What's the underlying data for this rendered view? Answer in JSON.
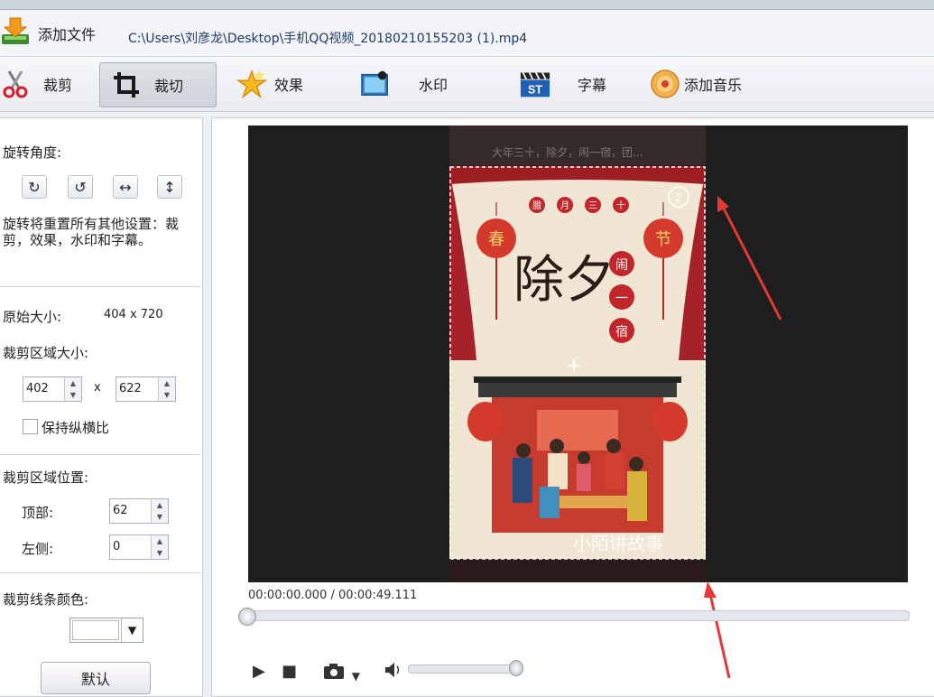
{
  "file_bar": {
    "add_file_label": "添加文件",
    "file_path": "C:\\Users\\刘彦龙\\Desktop\\手机QQ视频_20180210155203 (1).mp4"
  },
  "toolbar": {
    "items": [
      {
        "label": "裁剪",
        "icon": "scissors-icon"
      },
      {
        "label": "裁切",
        "icon": "crop-icon",
        "active": true
      },
      {
        "label": "效果",
        "icon": "star-effect-icon"
      },
      {
        "label": "水印",
        "icon": "watermark-icon"
      },
      {
        "label": "字幕",
        "icon": "subtitle-st-icon"
      },
      {
        "label": "添加音乐",
        "icon": "music-disc-icon"
      }
    ]
  },
  "left_panel": {
    "rotate_label": "旋转角度:",
    "rotate_buttons": [
      {
        "icon": "rotate-clockwise-icon",
        "glyph": "↻"
      },
      {
        "icon": "rotate-counterclockwise-icon",
        "glyph": "↺"
      },
      {
        "icon": "flip-horizontal-icon",
        "glyph": "↔"
      },
      {
        "icon": "flip-vertical-icon",
        "glyph": "↕"
      }
    ],
    "rotate_note": "旋转将重置所有其他设置：裁剪，效果，水印和字幕。",
    "original_size_label": "原始大小:",
    "original_size_value": "404 x 720",
    "crop_size_label": "裁剪区域大小:",
    "crop_width": "402",
    "crop_x": "x",
    "crop_height": "622",
    "keep_ratio_label": "保持纵横比",
    "crop_pos_label": "裁剪区域位置:",
    "top_label": "顶部:",
    "top_value": "62",
    "left_label": "左侧:",
    "left_value": "0",
    "line_color_label": "裁剪线条颜色:",
    "default_button": "默认"
  },
  "preview": {
    "poster_top_text": "大年三十，除夕，闹一宿，团...",
    "poster_title": "除夕",
    "poster_badges": [
      "腊",
      "月",
      "三",
      "十"
    ],
    "poster_side_badges": [
      "闹",
      "一",
      "宿"
    ],
    "poster_lanterns": [
      "春",
      "节"
    ],
    "poster_watermark": "小陌讲故事"
  },
  "player": {
    "timecode": "00:00:00.000 / 00:00:49.111"
  },
  "colors": {
    "arrow_red": "#e53935",
    "poster_red": "#c0262a",
    "crop_line": "#ffffff"
  }
}
